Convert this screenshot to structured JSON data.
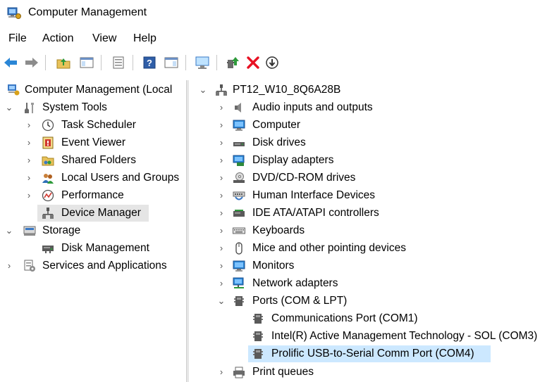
{
  "window": {
    "title": "Computer Management"
  },
  "menu": [
    "File",
    "Action",
    "View",
    "Help"
  ],
  "toolbar": {
    "icons": [
      "back-icon",
      "forward-icon",
      "up-folder-icon",
      "show-hide-console-tree-icon",
      "properties-icon",
      "help-icon",
      "show-hide-action-pane-icon",
      "monitor-icon",
      "update-driver-icon",
      "uninstall-icon",
      "disable-icon"
    ]
  },
  "left_tree": {
    "root": "Computer Management (Local",
    "system_tools": "System Tools",
    "task_scheduler": "Task Scheduler",
    "event_viewer": "Event Viewer",
    "shared_folders": "Shared Folders",
    "local_users": "Local Users and Groups",
    "performance": "Performance",
    "device_manager": "Device Manager",
    "storage": "Storage",
    "disk_management": "Disk Management",
    "services": "Services and Applications"
  },
  "device_tree": {
    "computer_name": "PT12_W10_8Q6A28B",
    "categories": {
      "audio": "Audio inputs and outputs",
      "computer": "Computer",
      "disk": "Disk drives",
      "display": "Display adapters",
      "dvd": "DVD/CD-ROM drives",
      "hid": "Human Interface Devices",
      "ide": "IDE ATA/ATAPI controllers",
      "keyboards": "Keyboards",
      "mice": "Mice and other pointing devices",
      "monitors": "Monitors",
      "network": "Network adapters",
      "ports": "Ports (COM & LPT)",
      "print": "Print queues"
    },
    "ports": {
      "com1": "Communications Port (COM1)",
      "com3": "Intel(R) Active Management Technology - SOL (COM3)",
      "com4": "Prolific USB-to-Serial Comm Port (COM4)"
    }
  },
  "colors": {
    "selection_gray": "#e5e5e5",
    "selection_blue": "#cce8ff",
    "uninstall_red": "#e81123",
    "accent_blue": "#1a73c8"
  }
}
